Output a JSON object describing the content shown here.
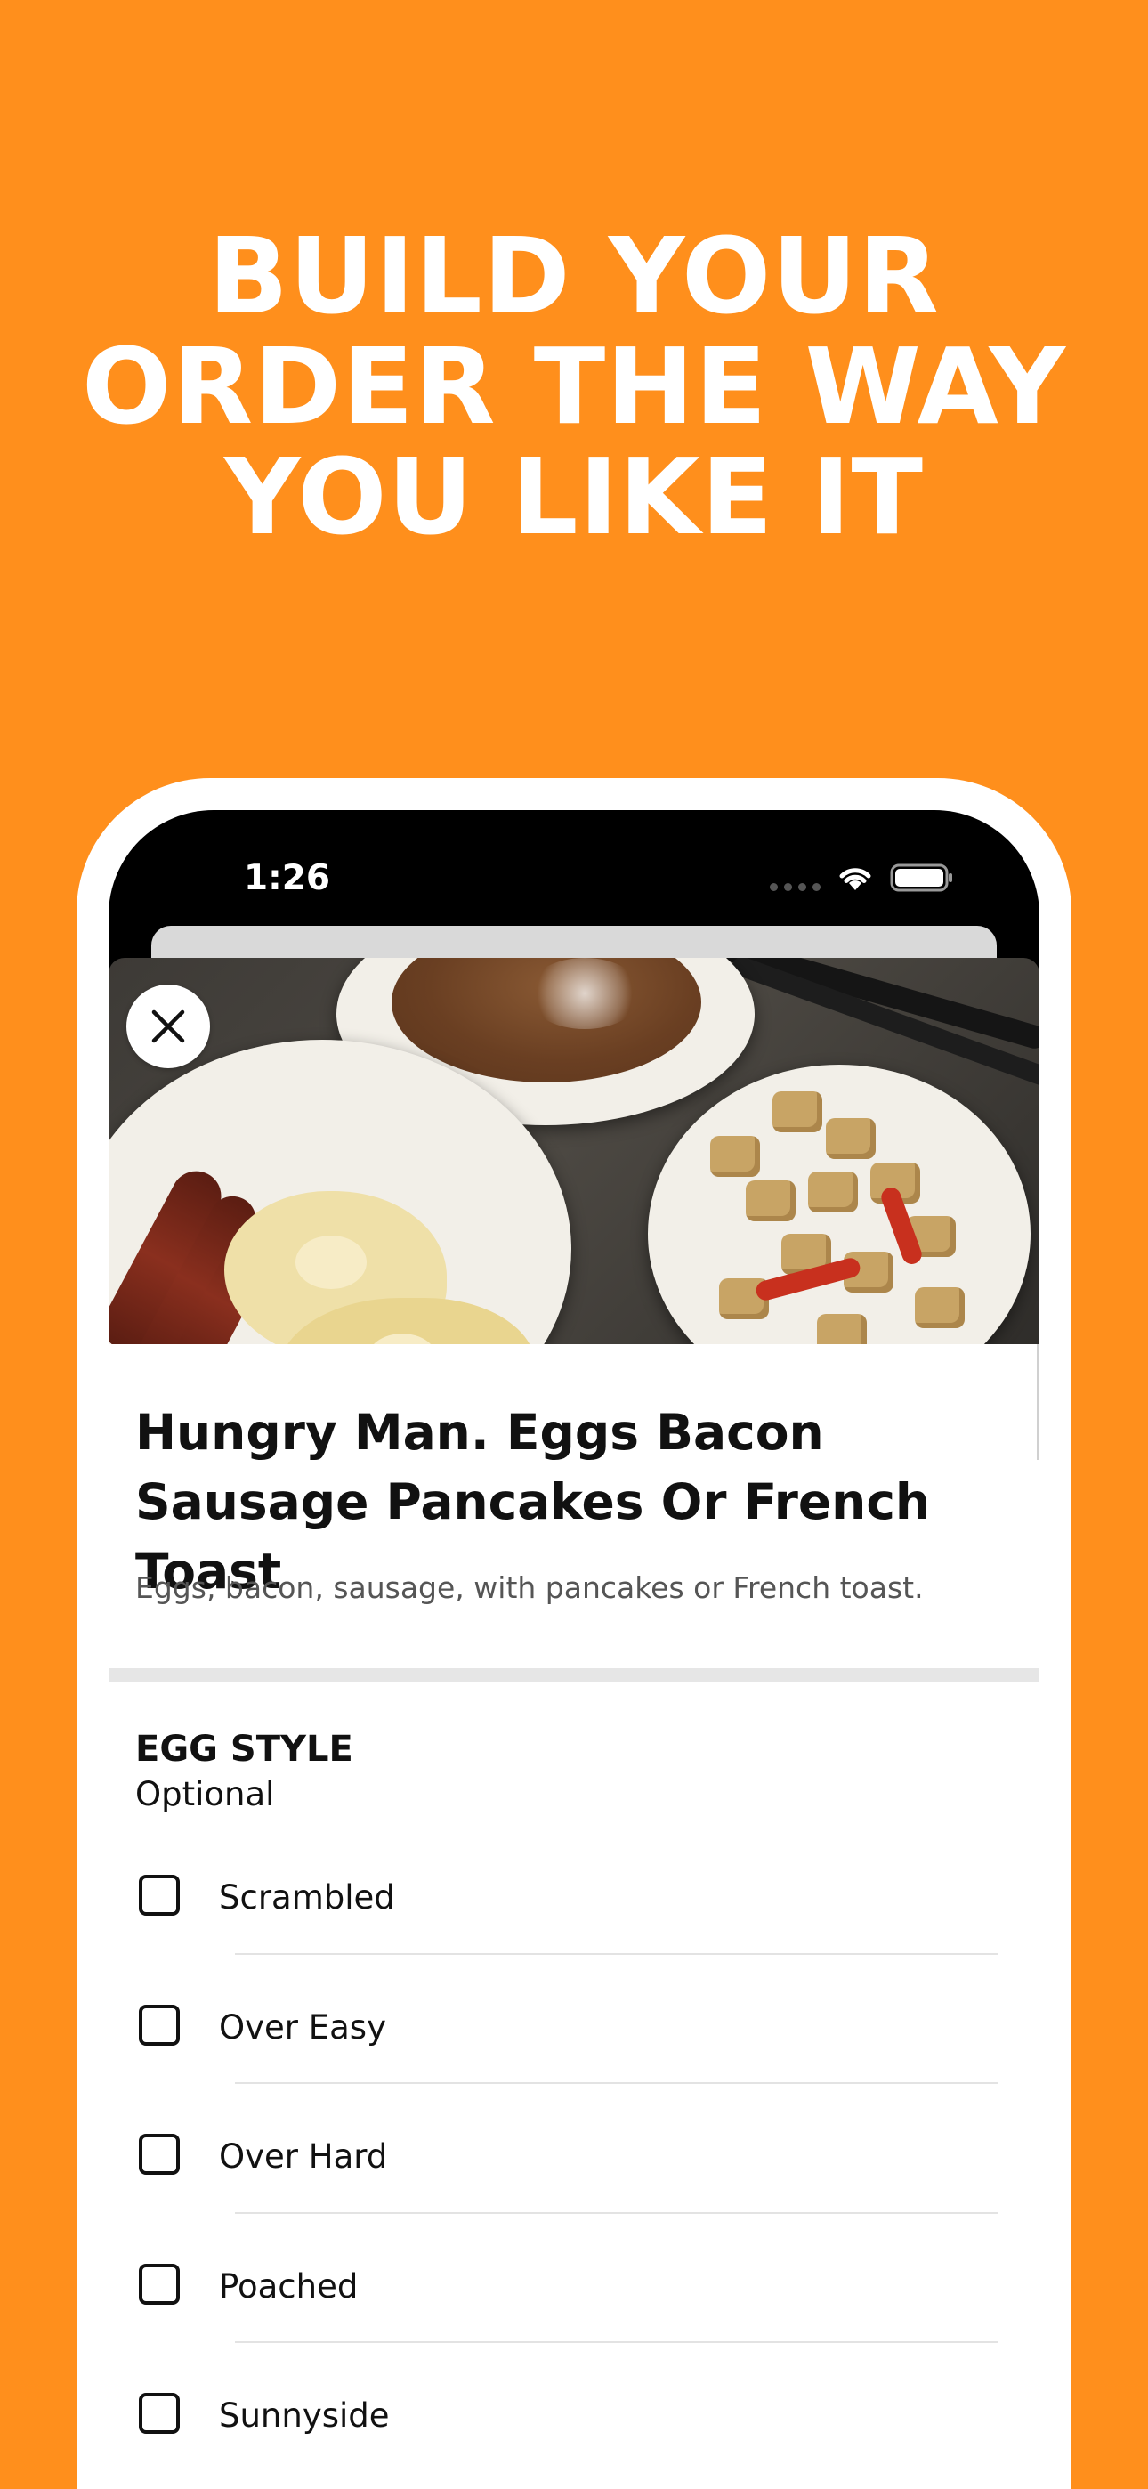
{
  "headline": {
    "line1": "BUILD YOUR",
    "line2": "ORDER THE WAY",
    "line3": "YOU LIKE IT"
  },
  "status_bar": {
    "time": "1:26"
  },
  "item": {
    "title": "Hungry Man. Eggs Bacon Sausage Pancakes Or French Toast",
    "description": "Eggs, bacon, sausage, with pancakes or French toast."
  },
  "option_group": {
    "title": "EGG STYLE",
    "subtitle": "Optional",
    "options": [
      {
        "label": "Scrambled",
        "checked": false
      },
      {
        "label": "Over Easy",
        "checked": false
      },
      {
        "label": "Over Hard",
        "checked": false
      },
      {
        "label": "Poached",
        "checked": false
      },
      {
        "label": "Sunnyside",
        "checked": false
      }
    ]
  },
  "colors": {
    "background": "#FF8F1C",
    "text": "#111111",
    "muted_text": "#555555"
  }
}
